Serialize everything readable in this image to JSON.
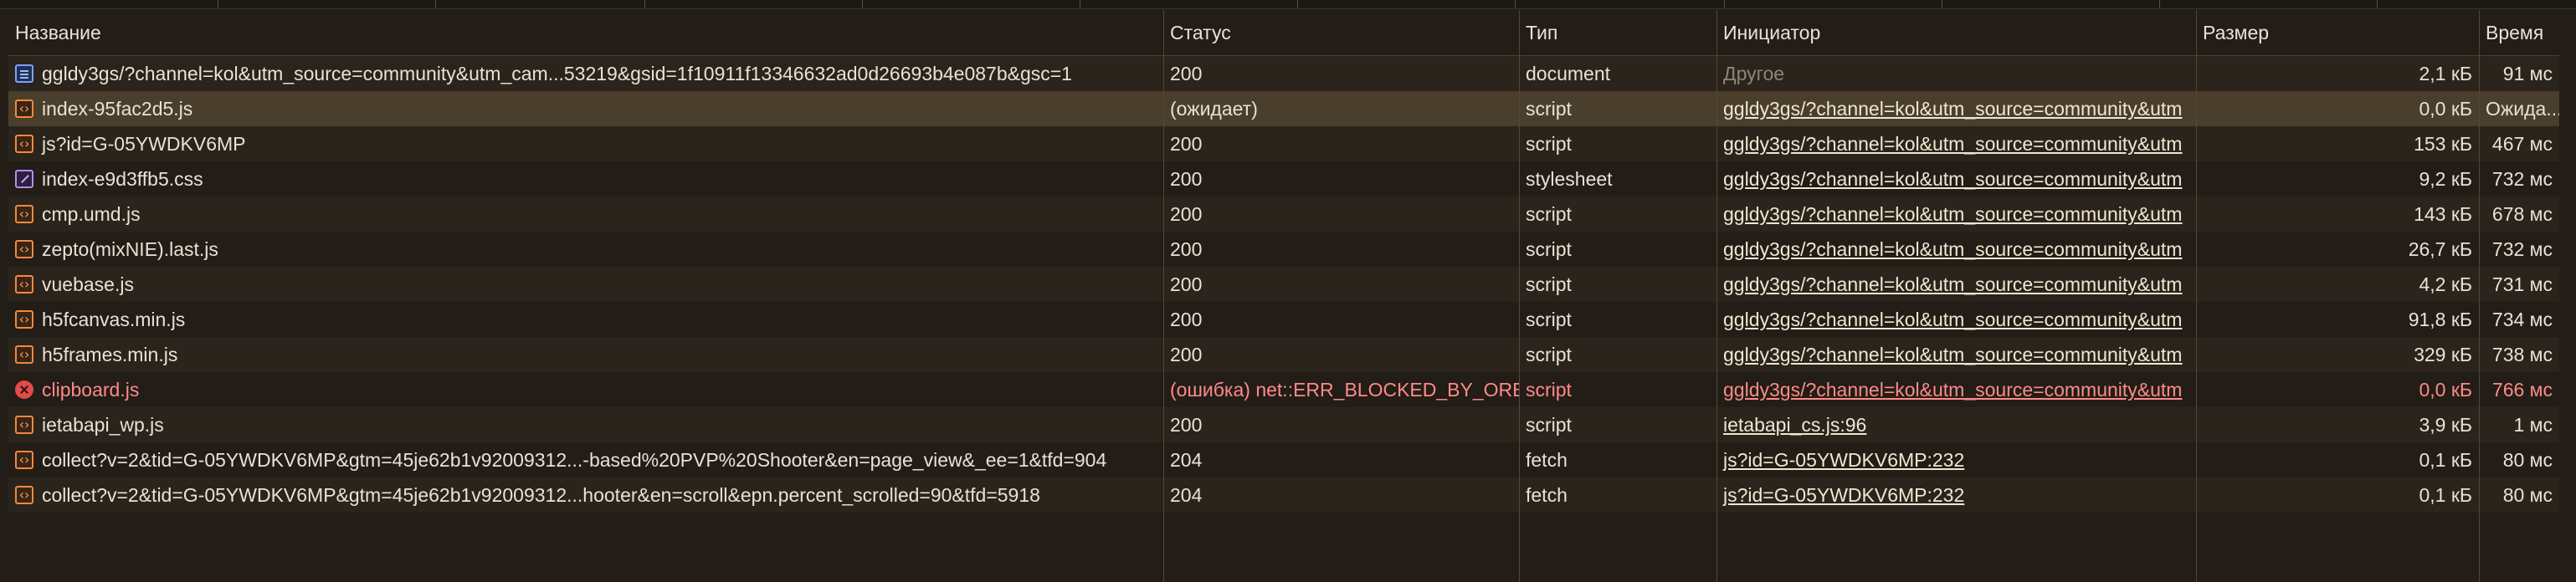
{
  "columns": {
    "name": "Название",
    "status": "Статус",
    "type": "Тип",
    "initiator": "Инициатор",
    "size": "Размер",
    "time": "Время"
  },
  "rows": [
    {
      "icon": "document-icon",
      "name": "ggldy3gs/?channel=kol&utm_source=community&utm_cam...53219&gsid=1f10911f13346632ad0d26693b4e087b&gsc=1",
      "status": "200",
      "type": "document",
      "initiator": "Другое",
      "size": "2,1 кБ",
      "time": "91 мс"
    },
    {
      "icon": "script-icon",
      "name": "index-95fac2d5.js",
      "status": "(ожидает)",
      "type": "script",
      "initiator": "ggldy3gs/?channel=kol&utm_source=community&utm",
      "size": "0,0 кБ",
      "time": "Ожида..."
    },
    {
      "icon": "script-icon",
      "name": "js?id=G-05YWDKV6MP",
      "status": "200",
      "type": "script",
      "initiator": "ggldy3gs/?channel=kol&utm_source=community&utm",
      "size": "153 кБ",
      "time": "467 мс"
    },
    {
      "icon": "stylesheet-icon",
      "name": "index-e9d3ffb5.css",
      "status": "200",
      "type": "stylesheet",
      "initiator": "ggldy3gs/?channel=kol&utm_source=community&utm",
      "size": "9,2 кБ",
      "time": "732 мс"
    },
    {
      "icon": "script-icon",
      "name": "cmp.umd.js",
      "status": "200",
      "type": "script",
      "initiator": "ggldy3gs/?channel=kol&utm_source=community&utm",
      "size": "143 кБ",
      "time": "678 мс"
    },
    {
      "icon": "script-icon",
      "name": "zepto(mixNIE).last.js",
      "status": "200",
      "type": "script",
      "initiator": "ggldy3gs/?channel=kol&utm_source=community&utm",
      "size": "26,7 кБ",
      "time": "732 мс"
    },
    {
      "icon": "script-icon",
      "name": "vuebase.js",
      "status": "200",
      "type": "script",
      "initiator": "ggldy3gs/?channel=kol&utm_source=community&utm",
      "size": "4,2 кБ",
      "time": "731 мс"
    },
    {
      "icon": "script-icon",
      "name": "h5fcanvas.min.js",
      "status": "200",
      "type": "script",
      "initiator": "ggldy3gs/?channel=kol&utm_source=community&utm",
      "size": "91,8 кБ",
      "time": "734 мс"
    },
    {
      "icon": "script-icon",
      "name": "h5frames.min.js",
      "status": "200",
      "type": "script",
      "initiator": "ggldy3gs/?channel=kol&utm_source=community&utm",
      "size": "329 кБ",
      "time": "738 мс"
    },
    {
      "icon": "error-icon",
      "name": "clipboard.js",
      "status": "(ошибка) net::ERR_BLOCKED_BY_ORB",
      "type": "script",
      "initiator": "ggldy3gs/?channel=kol&utm_source=community&utm",
      "size": "0,0 кБ",
      "time": "766 мс"
    },
    {
      "icon": "script-icon",
      "name": "ietabapi_wp.js",
      "status": "200",
      "type": "script",
      "initiator": "ietabapi_cs.js:96",
      "size": "3,9 кБ",
      "time": "1 мс"
    },
    {
      "icon": "script-icon",
      "name": "collect?v=2&tid=G-05YWDKV6MP&gtm=45je62b1v92009312...-based%20PVP%20Shooter&en=page_view&_ee=1&tfd=904",
      "status": "204",
      "type": "fetch",
      "initiator": "js?id=G-05YWDKV6MP:232",
      "size": "0,1 кБ",
      "time": "80 мс"
    },
    {
      "icon": "script-icon",
      "name": "collect?v=2&tid=G-05YWDKV6MP&gtm=45je62b1v92009312...hooter&en=scroll&epn.percent_scrolled=90&tfd=5918",
      "status": "204",
      "type": "fetch",
      "initiator": "js?id=G-05YWDKV6MP:232",
      "size": "0,1 кБ",
      "time": "80 мс"
    }
  ],
  "state": {
    "selected_row": 1,
    "error_rows": [
      9
    ],
    "muted_initiator_rows": [
      0
    ]
  },
  "colors": {
    "background": "#221d16",
    "row_alt": "#2a241c",
    "selected": "#4a3f2c",
    "error_text": "#ff8a8a",
    "document_icon": "#7ea0ff",
    "script_icon": "#f2883f",
    "stylesheet_icon": "#b88cf0",
    "error_icon": "#e34a4a"
  }
}
